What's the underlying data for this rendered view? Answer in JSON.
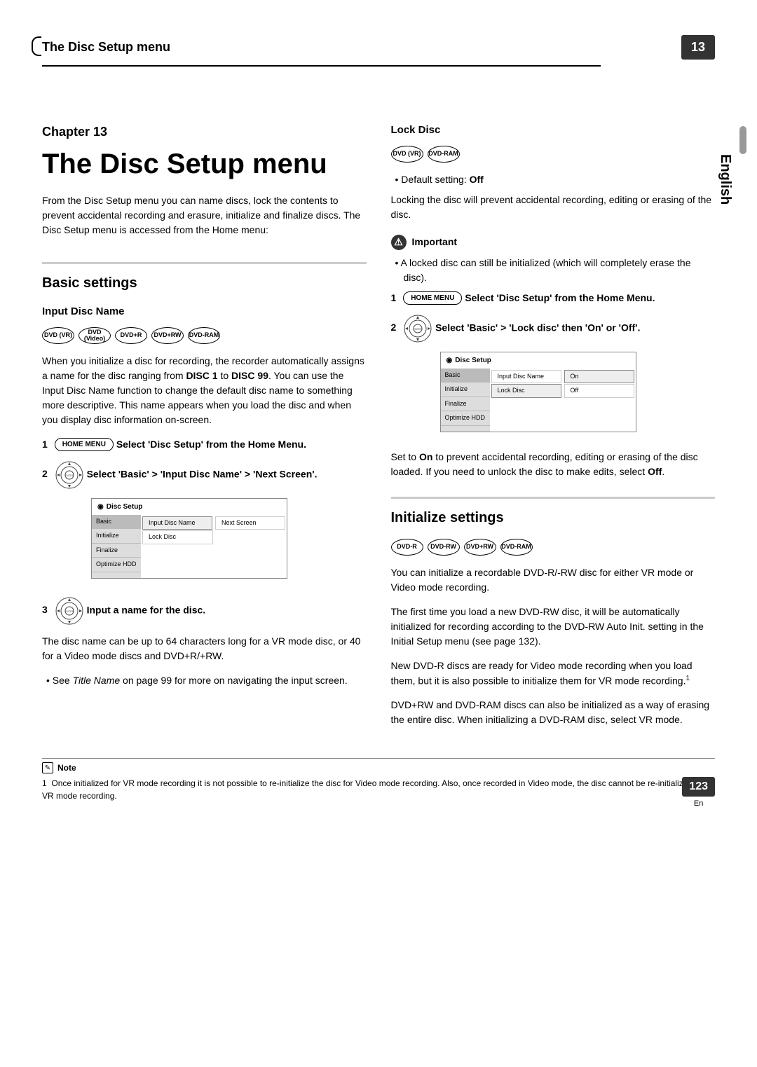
{
  "header": {
    "title": "The Disc Setup menu",
    "chapter_badge": "13"
  },
  "vertical_lang": "English",
  "chapter_label": "Chapter 13",
  "main_title": "The Disc Setup menu",
  "intro": "From the Disc Setup menu you can name discs, lock the contents to prevent accidental recording and erasure, initialize and finalize discs. The Disc Setup menu is accessed from the Home menu:",
  "basic_settings": {
    "heading": "Basic settings",
    "input_disc_name": {
      "heading": "Input Disc Name",
      "badges": [
        "DVD (VR)",
        "DVD (Video)",
        "DVD+R",
        "DVD+RW",
        "DVD-RAM"
      ],
      "para1_a": "When you initialize a disc for recording, the recorder automatically assigns a name for the disc ranging from ",
      "para1_bold1": "DISC 1",
      "para1_b": " to ",
      "para1_bold2": "DISC 99",
      "para1_c": ". You can use the Input Disc Name function to change the default disc name to something more descriptive. This name appears when you load the disc and when you display disc information on-screen.",
      "step1_num": "1",
      "step1_btn": "HOME MENU",
      "step1_text": "Select 'Disc Setup' from the Home Menu.",
      "step2_num": "2",
      "step2_text": "Select 'Basic' > 'Input Disc Name' > 'Next Screen'.",
      "step3_num": "3",
      "step3_text": "Input a name for the disc.",
      "after3": "The disc name can be up to 64 characters long for a VR mode disc, or 40 for a Video mode discs and DVD+R/+RW.",
      "bullet_a": "• See ",
      "bullet_italic": "Title Name",
      "bullet_b": " on page 99 for more on navigating the input screen."
    },
    "menu1": {
      "title": "Disc Setup",
      "sidebar": [
        "Basic",
        "Initialize",
        "Finalize",
        "Optimize HDD"
      ],
      "rows": [
        [
          "Input Disc Name",
          "Next Screen"
        ],
        [
          "Lock Disc",
          ""
        ]
      ]
    }
  },
  "lock_disc": {
    "heading": "Lock Disc",
    "badges": [
      "DVD (VR)",
      "DVD-RAM"
    ],
    "default_label": "• Default setting: ",
    "default_value": "Off",
    "para": "Locking the disc will prevent accidental recording, editing or erasing of the disc.",
    "important_label": "Important",
    "important_bullet": "• A locked disc can still be initialized (which will completely erase the disc).",
    "step1_num": "1",
    "step1_btn": "HOME MENU",
    "step1_text": "Select 'Disc Setup' from the Home Menu.",
    "step2_num": "2",
    "step2_text": "Select 'Basic' > 'Lock disc' then 'On' or 'Off'.",
    "menu2": {
      "title": "Disc Setup",
      "sidebar": [
        "Basic",
        "Initialize",
        "Finalize",
        "Optimize HDD"
      ],
      "rows": [
        [
          "Input Disc Name",
          "On"
        ],
        [
          "Lock Disc",
          "Off"
        ]
      ]
    },
    "after_a": "Set to ",
    "after_bold1": "On",
    "after_b": " to prevent accidental recording, editing or erasing of the disc loaded. If you need to unlock the disc to make edits, select ",
    "after_bold2": "Off",
    "after_c": "."
  },
  "initialize": {
    "heading": "Initialize settings",
    "badges": [
      "DVD-R",
      "DVD-RW",
      "DVD+RW",
      "DVD-RAM"
    ],
    "p1": "You can initialize a recordable DVD-R/-RW disc for either VR mode or Video mode recording.",
    "p2": "The first time you load a new DVD-RW disc, it will be automatically initialized for recording according to the DVD-RW Auto Init. setting in the Initial Setup menu (see page 132).",
    "p3": "New DVD-R discs are ready for Video mode recording when you load them, but it is also possible to initialize them for VR mode recording.",
    "p3_sup": "1",
    "p4": "DVD+RW and DVD-RAM discs can also be initialized as a way of erasing the entire disc. When initializing a DVD-RAM disc, select VR mode."
  },
  "footnote": {
    "note_label": "Note",
    "num": "1",
    "text": "Once initialized for VR mode recording it is not possible to re-initialize the disc for Video mode recording. Also, once recorded in Video mode, the disc cannot be re-initialized for VR mode recording."
  },
  "footer": {
    "page": "123",
    "lang": "En"
  }
}
